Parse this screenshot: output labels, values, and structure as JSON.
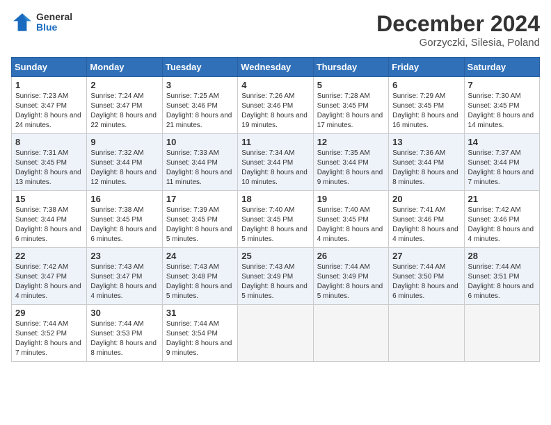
{
  "header": {
    "logo_general": "General",
    "logo_blue": "Blue",
    "month": "December 2024",
    "location": "Gorzyczki, Silesia, Poland"
  },
  "days_of_week": [
    "Sunday",
    "Monday",
    "Tuesday",
    "Wednesday",
    "Thursday",
    "Friday",
    "Saturday"
  ],
  "weeks": [
    [
      {
        "num": "1",
        "sunrise": "7:23 AM",
        "sunset": "3:47 PM",
        "daylight": "8 hours and 24 minutes."
      },
      {
        "num": "2",
        "sunrise": "7:24 AM",
        "sunset": "3:47 PM",
        "daylight": "8 hours and 22 minutes."
      },
      {
        "num": "3",
        "sunrise": "7:25 AM",
        "sunset": "3:46 PM",
        "daylight": "8 hours and 21 minutes."
      },
      {
        "num": "4",
        "sunrise": "7:26 AM",
        "sunset": "3:46 PM",
        "daylight": "8 hours and 19 minutes."
      },
      {
        "num": "5",
        "sunrise": "7:28 AM",
        "sunset": "3:45 PM",
        "daylight": "8 hours and 17 minutes."
      },
      {
        "num": "6",
        "sunrise": "7:29 AM",
        "sunset": "3:45 PM",
        "daylight": "8 hours and 16 minutes."
      },
      {
        "num": "7",
        "sunrise": "7:30 AM",
        "sunset": "3:45 PM",
        "daylight": "8 hours and 14 minutes."
      }
    ],
    [
      {
        "num": "8",
        "sunrise": "7:31 AM",
        "sunset": "3:45 PM",
        "daylight": "8 hours and 13 minutes."
      },
      {
        "num": "9",
        "sunrise": "7:32 AM",
        "sunset": "3:44 PM",
        "daylight": "8 hours and 12 minutes."
      },
      {
        "num": "10",
        "sunrise": "7:33 AM",
        "sunset": "3:44 PM",
        "daylight": "8 hours and 11 minutes."
      },
      {
        "num": "11",
        "sunrise": "7:34 AM",
        "sunset": "3:44 PM",
        "daylight": "8 hours and 10 minutes."
      },
      {
        "num": "12",
        "sunrise": "7:35 AM",
        "sunset": "3:44 PM",
        "daylight": "8 hours and 9 minutes."
      },
      {
        "num": "13",
        "sunrise": "7:36 AM",
        "sunset": "3:44 PM",
        "daylight": "8 hours and 8 minutes."
      },
      {
        "num": "14",
        "sunrise": "7:37 AM",
        "sunset": "3:44 PM",
        "daylight": "8 hours and 7 minutes."
      }
    ],
    [
      {
        "num": "15",
        "sunrise": "7:38 AM",
        "sunset": "3:44 PM",
        "daylight": "8 hours and 6 minutes."
      },
      {
        "num": "16",
        "sunrise": "7:38 AM",
        "sunset": "3:45 PM",
        "daylight": "8 hours and 6 minutes."
      },
      {
        "num": "17",
        "sunrise": "7:39 AM",
        "sunset": "3:45 PM",
        "daylight": "8 hours and 5 minutes."
      },
      {
        "num": "18",
        "sunrise": "7:40 AM",
        "sunset": "3:45 PM",
        "daylight": "8 hours and 5 minutes."
      },
      {
        "num": "19",
        "sunrise": "7:40 AM",
        "sunset": "3:45 PM",
        "daylight": "8 hours and 4 minutes."
      },
      {
        "num": "20",
        "sunrise": "7:41 AM",
        "sunset": "3:46 PM",
        "daylight": "8 hours and 4 minutes."
      },
      {
        "num": "21",
        "sunrise": "7:42 AM",
        "sunset": "3:46 PM",
        "daylight": "8 hours and 4 minutes."
      }
    ],
    [
      {
        "num": "22",
        "sunrise": "7:42 AM",
        "sunset": "3:47 PM",
        "daylight": "8 hours and 4 minutes."
      },
      {
        "num": "23",
        "sunrise": "7:43 AM",
        "sunset": "3:47 PM",
        "daylight": "8 hours and 4 minutes."
      },
      {
        "num": "24",
        "sunrise": "7:43 AM",
        "sunset": "3:48 PM",
        "daylight": "8 hours and 5 minutes."
      },
      {
        "num": "25",
        "sunrise": "7:43 AM",
        "sunset": "3:49 PM",
        "daylight": "8 hours and 5 minutes."
      },
      {
        "num": "26",
        "sunrise": "7:44 AM",
        "sunset": "3:49 PM",
        "daylight": "8 hours and 5 minutes."
      },
      {
        "num": "27",
        "sunrise": "7:44 AM",
        "sunset": "3:50 PM",
        "daylight": "8 hours and 6 minutes."
      },
      {
        "num": "28",
        "sunrise": "7:44 AM",
        "sunset": "3:51 PM",
        "daylight": "8 hours and 6 minutes."
      }
    ],
    [
      {
        "num": "29",
        "sunrise": "7:44 AM",
        "sunset": "3:52 PM",
        "daylight": "8 hours and 7 minutes."
      },
      {
        "num": "30",
        "sunrise": "7:44 AM",
        "sunset": "3:53 PM",
        "daylight": "8 hours and 8 minutes."
      },
      {
        "num": "31",
        "sunrise": "7:44 AM",
        "sunset": "3:54 PM",
        "daylight": "8 hours and 9 minutes."
      },
      null,
      null,
      null,
      null
    ]
  ]
}
